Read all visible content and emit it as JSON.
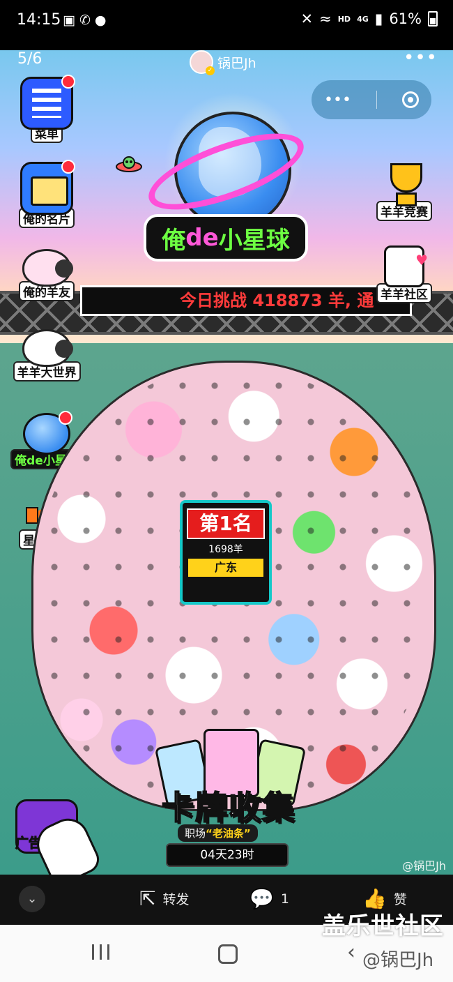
{
  "status_bar": {
    "time": "14:15",
    "battery": "61%",
    "network": "4G",
    "hd": "HD"
  },
  "header": {
    "page_indicator": "5/6",
    "username": "锅巴Jh",
    "more": "•••"
  },
  "capsule": {
    "more": "•••"
  },
  "planet": {
    "title_part1": "俺",
    "title_part2": "de",
    "title_part3": "小星球"
  },
  "ticker": {
    "text": "今日挑战 418873 羊, 通"
  },
  "left_menu": [
    {
      "label": "菜单",
      "icon": "list-icon",
      "badge": true
    },
    {
      "label": "俺的名片",
      "icon": "card-icon",
      "badge": true
    },
    {
      "label": "俺的羊友",
      "icon": "sheep-friends-icon",
      "badge": false
    },
    {
      "label": "羊羊大世界",
      "icon": "sheep-world-icon",
      "badge": false
    },
    {
      "label": "俺de小星球",
      "icon": "planet-icon",
      "badge": true
    },
    {
      "label": "星际直聘",
      "icon": "megaphone-icon",
      "badge": false
    }
  ],
  "right_menu": [
    {
      "label": "羊羊竞赛",
      "icon": "trophy-icon"
    },
    {
      "label": "羊羊社区",
      "icon": "community-icon"
    }
  ],
  "rank": {
    "title": "第1名",
    "count": "1698羊",
    "region": "广东"
  },
  "card_collection": {
    "title": "卡牌收集",
    "subtitle_prefix": "职场",
    "subtitle_highlight": "“老油条”",
    "timer": "04天23时"
  },
  "ad": {
    "label": "广告"
  },
  "watermark_author": "@锅巴Jh",
  "actions": {
    "share_label": "转发",
    "comment_count": "1",
    "like_label": "赞"
  },
  "forum_watermark": "盖乐世社区",
  "forum_watermark_author": "@锅巴Jh",
  "colors": {
    "accent_pink": "#ff4fd8",
    "accent_green": "#6dff42",
    "ticker_red": "#ff3b3b",
    "rank_red": "#e51d1d",
    "rank_yellow": "#ffd21a"
  }
}
